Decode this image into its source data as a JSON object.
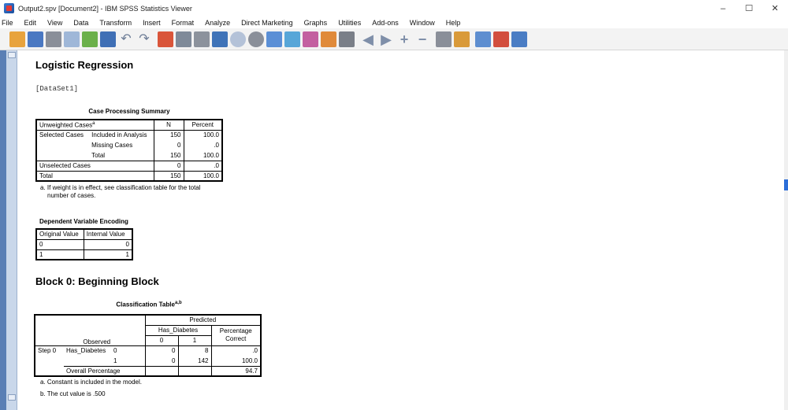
{
  "window": {
    "title": "Output2.spv [Document2] - IBM SPSS Statistics Viewer",
    "controls": [
      "–",
      "☐",
      "✕"
    ]
  },
  "menu": [
    "File",
    "Edit",
    "View",
    "Data",
    "Transform",
    "Insert",
    "Format",
    "Analyze",
    "Direct Marketing",
    "Graphs",
    "Utilities",
    "Add-ons",
    "Window",
    "Help"
  ],
  "toolbar": {
    "icons": [
      "open-icon",
      "save-icon",
      "print-icon",
      "print-preview-icon",
      "export-icon",
      "goto-data-icon",
      "undo-icon",
      "redo-icon",
      "goto-case-icon",
      "goto-variable-icon",
      "variables-icon",
      "designate-window-icon",
      "insert-icon",
      "select-icon",
      "show-icon",
      "hide-icon",
      "promote-icon",
      "demote-icon",
      "expand-icon",
      "collapse-icon",
      "show-all-icon",
      "hide-all-icon",
      "insert-heading-icon",
      "insert-title-icon",
      "insert-text-icon"
    ]
  },
  "output": {
    "heading_logistic": "Logistic Regression",
    "dataset_label": "[DataSet1]",
    "case_processing": {
      "title": "Case Processing Summary",
      "col_header_label": "Unweighted Cases",
      "col_header_sup": "a",
      "col_n": "N",
      "col_percent": "Percent",
      "rows": [
        {
          "label1": "Selected Cases",
          "label2": "Included in Analysis",
          "n": "150",
          "pct": "100.0"
        },
        {
          "label1": "",
          "label2": "Missing Cases",
          "n": "0",
          "pct": ".0"
        },
        {
          "label1": "",
          "label2": "Total",
          "n": "150",
          "pct": "100.0"
        },
        {
          "label1": "Unselected Cases",
          "label2": "",
          "n": "0",
          "pct": ".0"
        },
        {
          "label1": "Total",
          "label2": "",
          "n": "150",
          "pct": "100.0"
        }
      ],
      "footnote_line1": "a. If weight is in effect, see classification table for the total",
      "footnote_line2": "number of cases."
    },
    "dependent_encoding": {
      "title": "Dependent Variable Encoding",
      "col_original": "Original Value",
      "col_internal": "Internal Value",
      "rows": [
        {
          "original": "0",
          "internal": "0"
        },
        {
          "original": "1",
          "internal": "1"
        }
      ]
    },
    "heading_block0": "Block 0: Beginning Block",
    "classification": {
      "title": "Classification Table",
      "title_sup": "a,b",
      "predicted": "Predicted",
      "var": "Has_Diabetes",
      "val0": "0",
      "val1": "1",
      "pct_correct_line1": "Percentage",
      "pct_correct_line2": "Correct",
      "observed": "Observed",
      "step": "Step 0",
      "row_var": "Has_Diabetes",
      "row0_label": "0",
      "row0_c0": "0",
      "row0_c1": "8",
      "row0_pct": ".0",
      "row1_label": "1",
      "row1_c0": "0",
      "row1_c1": "142",
      "row1_pct": "100.0",
      "overall_label": "Overall Percentage",
      "overall_pct": "94.7",
      "footnote_a": "a. Constant is included in the model.",
      "footnote_b": "b. The cut value is .500"
    }
  }
}
